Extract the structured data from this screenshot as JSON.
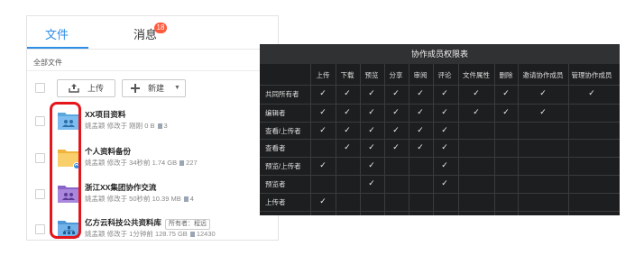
{
  "tabs": {
    "files": "文件",
    "messages": "消息",
    "message_count": "18"
  },
  "breadcrumb": "全部文件",
  "toolbar": {
    "upload_label": "上传",
    "new_label": "新建"
  },
  "files": [
    {
      "name": "XX项目资料",
      "owner": "姚孟颖",
      "modified": "修改于 刚刚",
      "size": "0 B",
      "count": "3",
      "icon": "team-folder-icon",
      "tag": ""
    },
    {
      "name": "个人资料备份",
      "owner": "姚孟颖",
      "modified": "修改于 34秒前",
      "size": "1.74 GB",
      "count": "227",
      "icon": "sync-folder-icon",
      "tag": ""
    },
    {
      "name": "浙江XX集团协作交流",
      "owner": "姚孟颖",
      "modified": "修改于 50秒前",
      "size": "10.39 MB",
      "count": "4",
      "icon": "group-folder-icon",
      "tag": ""
    },
    {
      "name": "亿方云科技公共资料库",
      "owner": "姚孟颖",
      "modified": "修改于 1分钟前",
      "size": "128.75 GB",
      "count": "12430",
      "icon": "org-folder-icon",
      "tag": "所有者：程远"
    }
  ],
  "permissions": {
    "title": "协作成员权限表",
    "columns": [
      "上传",
      "下载",
      "预览",
      "分享",
      "审阅",
      "评论",
      "文件属性",
      "删除",
      "邀请协作成员",
      "管理协作成员"
    ],
    "rows": [
      {
        "role": "共同所有者",
        "marks": [
          "✓",
          "✓",
          "✓",
          "✓",
          "✓",
          "✓",
          "✓",
          "✓",
          "✓",
          "✓"
        ]
      },
      {
        "role": "编辑者",
        "marks": [
          "✓",
          "✓",
          "✓",
          "✓",
          "✓",
          "✓",
          "✓",
          "✓",
          "✓",
          ""
        ]
      },
      {
        "role": "查看/上传者",
        "marks": [
          "✓",
          "✓",
          "✓",
          "✓",
          "✓",
          "✓",
          "",
          "",
          "",
          ""
        ]
      },
      {
        "role": "查看者",
        "marks": [
          "",
          "✓",
          "✓",
          "✓",
          "✓",
          "✓",
          "",
          "",
          "",
          ""
        ]
      },
      {
        "role": "预览/上传者",
        "marks": [
          "✓",
          "",
          "✓",
          "",
          "",
          "✓",
          "",
          "",
          "",
          ""
        ]
      },
      {
        "role": "预览者",
        "marks": [
          "",
          "",
          "✓",
          "",
          "",
          "✓",
          "",
          "",
          "",
          ""
        ]
      },
      {
        "role": "上传者",
        "marks": [
          "✓",
          "",
          "",
          "",
          "",
          "",
          "",
          "",
          "",
          ""
        ]
      }
    ]
  },
  "colors": {
    "accent": "#2e8de6",
    "badge": "#ff5a3c",
    "highlight": "#e4151b",
    "table_bg": "#1d1e1f"
  }
}
